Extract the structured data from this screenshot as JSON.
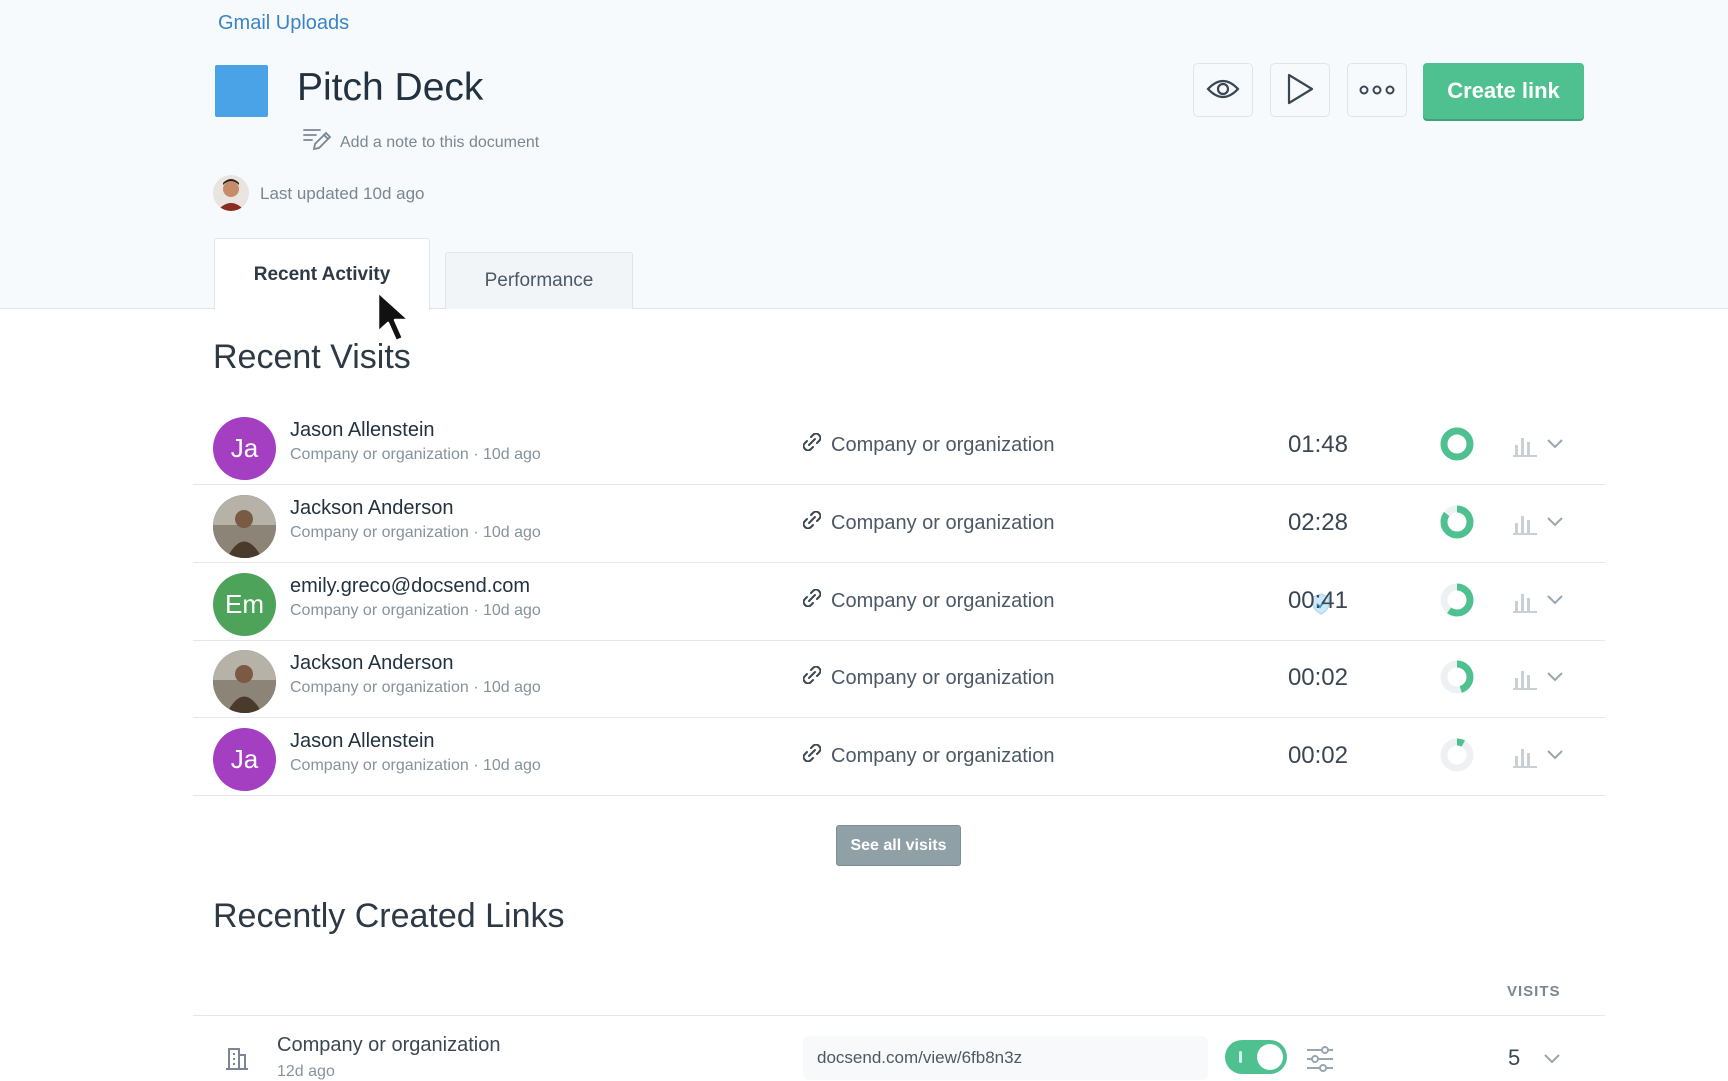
{
  "header": {
    "folder": "Gmail Uploads",
    "title": "Pitch Deck",
    "note_placeholder": "Add a note to this document",
    "last_updated": "Last updated 10d ago",
    "create_link": "Create link"
  },
  "tabs": [
    {
      "label": "Recent Activity",
      "active": true
    },
    {
      "label": "Performance",
      "active": false
    }
  ],
  "recent_visits": {
    "title": "Recent Visits",
    "rows": [
      {
        "name": "Jason Allenstein",
        "initials": "Ja",
        "avatar_color": "#a43fc1",
        "org": "Company or organization",
        "age": "10d ago",
        "link": "Company or organization",
        "duration": "01:48",
        "completion": 1.0,
        "verified": false
      },
      {
        "name": "Jackson Anderson",
        "initials": "",
        "avatar_color": "#6b5a4a",
        "org": "Company or organization",
        "age": "10d ago",
        "link": "Company or organization",
        "duration": "02:28",
        "completion": 0.85,
        "verified": false
      },
      {
        "name": "emily.greco@docsend.com",
        "initials": "Em",
        "avatar_color": "#4ea35a",
        "org": "Company or organization",
        "age": "10d ago",
        "link": "Company or organization",
        "duration": "00:41",
        "completion": 0.6,
        "verified": true
      },
      {
        "name": "Jackson Anderson",
        "initials": "",
        "avatar_color": "#6b5a4a",
        "org": "Company or organization",
        "age": "10d ago",
        "link": "Company or organization",
        "duration": "00:02",
        "completion": 0.45,
        "verified": false
      },
      {
        "name": "Jason Allenstein",
        "initials": "Ja",
        "avatar_color": "#a43fc1",
        "org": "Company or organization",
        "age": "10d ago",
        "link": "Company or organization",
        "duration": "00:02",
        "completion": 0.08,
        "verified": false
      }
    ],
    "see_all": "See all visits"
  },
  "recent_links": {
    "title": "Recently Created Links",
    "visits_header": "VISITS",
    "rows": [
      {
        "name": "Company or organization",
        "age": "12d ago",
        "url": "docsend.com/view/6fb8n3z",
        "enabled": true,
        "visits": "5"
      }
    ]
  },
  "colors": {
    "accent": "#4fc190",
    "link_blue": "#3b84c4",
    "doc_blue": "#4aa3e6"
  }
}
